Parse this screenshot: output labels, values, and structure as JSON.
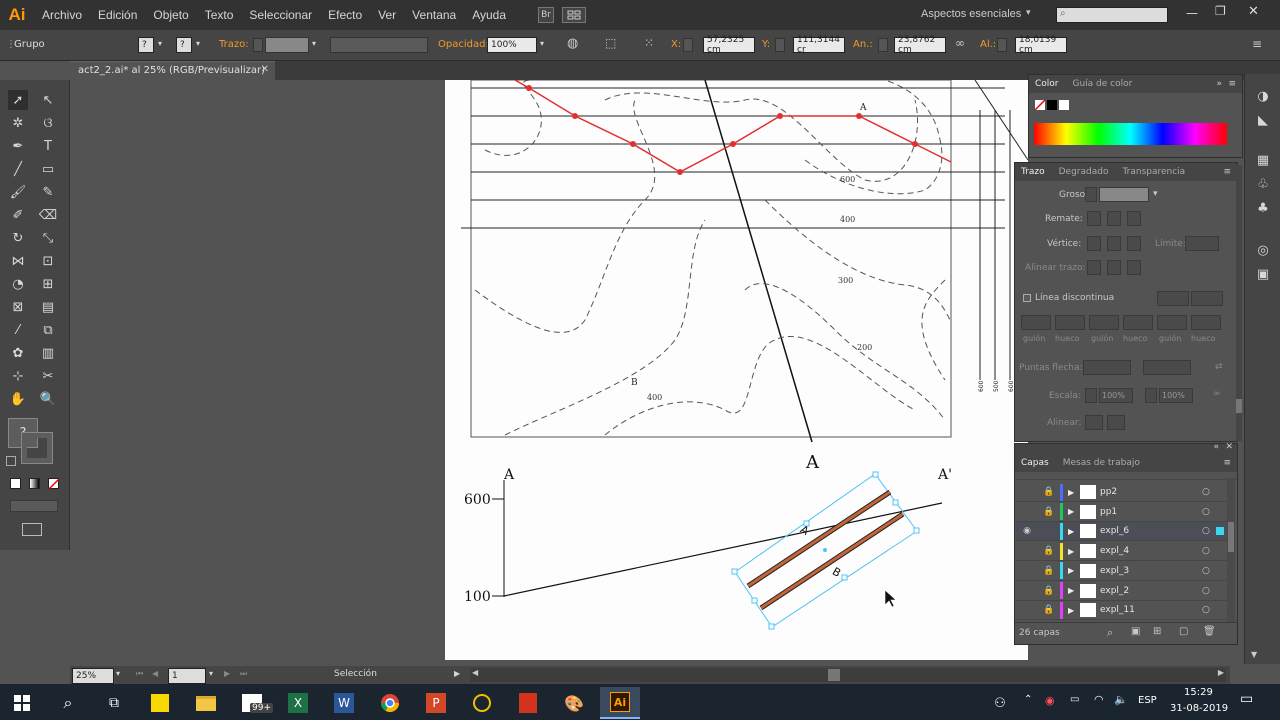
{
  "app": {
    "logo": "Ai"
  },
  "menu": [
    "Archivo",
    "Edición",
    "Objeto",
    "Texto",
    "Seleccionar",
    "Efecto",
    "Ver",
    "Ventana",
    "Ayuda"
  ],
  "menubar": {
    "br_label": "Br",
    "workspace": "Aspectos esenciales",
    "search_placeholder": ""
  },
  "control": {
    "selection_type": "Grupo",
    "stroke_label": "Trazo:",
    "opacity_label": "Opacidad:",
    "opacity_value": "100%",
    "x_label": "X:",
    "x_value": "57,2325 cm",
    "y_label": "Y:",
    "y_value": "111,3144 cr",
    "w_label": "An.:",
    "w_value": "23,8762 cm",
    "h_label": "Al.:",
    "h_value": "18,0139 cm"
  },
  "document": {
    "tab_title": "act2_2.ai* al 25% (RGB/Previsualizar)"
  },
  "toolbar": {
    "question_mark": "?"
  },
  "artwork": {
    "contour_labels": [
      "600",
      "400",
      "300",
      "200",
      "400"
    ],
    "point_a_small": "A",
    "point_b_small": "B",
    "section_label_a": "A",
    "profile_start": "A",
    "profile_end": "A'",
    "profile_y_600": "600",
    "profile_y_100": "100",
    "dragged_label_a": "A",
    "dragged_label_b": "B",
    "side_numbers": [
      "600",
      "500",
      "600"
    ]
  },
  "color_panel": {
    "tab_active": "Color",
    "tab_inactive": "Guía de color"
  },
  "stroke_panel": {
    "tabs": [
      "Trazo",
      "Degradado",
      "Transparencia"
    ],
    "weight_label": "Grosor:",
    "cap_label": "Remate:",
    "corner_label": "Vértice:",
    "limit_label": "Límite:",
    "align_label": "Alinear trazo:",
    "dashed_label": "Línea discontinua",
    "dash_labels": [
      "guión",
      "hueco",
      "guión",
      "hueco",
      "guión",
      "hueco"
    ],
    "arrowheads_label": "Puntas flecha:",
    "scale_label": "Escala:",
    "scale_value_1": "100%",
    "scale_value_2": "100%",
    "align_arrow_label": "Alinear:"
  },
  "layers_panel": {
    "tabs": [
      "Capas",
      "Mesas de trabajo"
    ],
    "layers": [
      {
        "name": "pp2",
        "color": "#4f6bff",
        "selected": false,
        "eye": false
      },
      {
        "name": "pp1",
        "color": "#22c55e",
        "selected": false,
        "eye": false
      },
      {
        "name": "expl_6",
        "color": "#38d9f0",
        "selected": true,
        "eye": true
      },
      {
        "name": "expl_4",
        "color": "#f2e32a",
        "selected": false,
        "eye": false
      },
      {
        "name": "expl_3",
        "color": "#38d9f0",
        "selected": false,
        "eye": false
      },
      {
        "name": "expl_2",
        "color": "#e040fb",
        "selected": false,
        "eye": false
      },
      {
        "name": "expl_11",
        "color": "#e040fb",
        "selected": false,
        "eye": false
      }
    ],
    "count": "26 capas"
  },
  "status": {
    "zoom": "25%",
    "page": "1",
    "tool": "Selección"
  },
  "taskbar": {
    "badge": "99+",
    "lang": "ESP",
    "time": "15:29",
    "date": "31-08-2019"
  }
}
